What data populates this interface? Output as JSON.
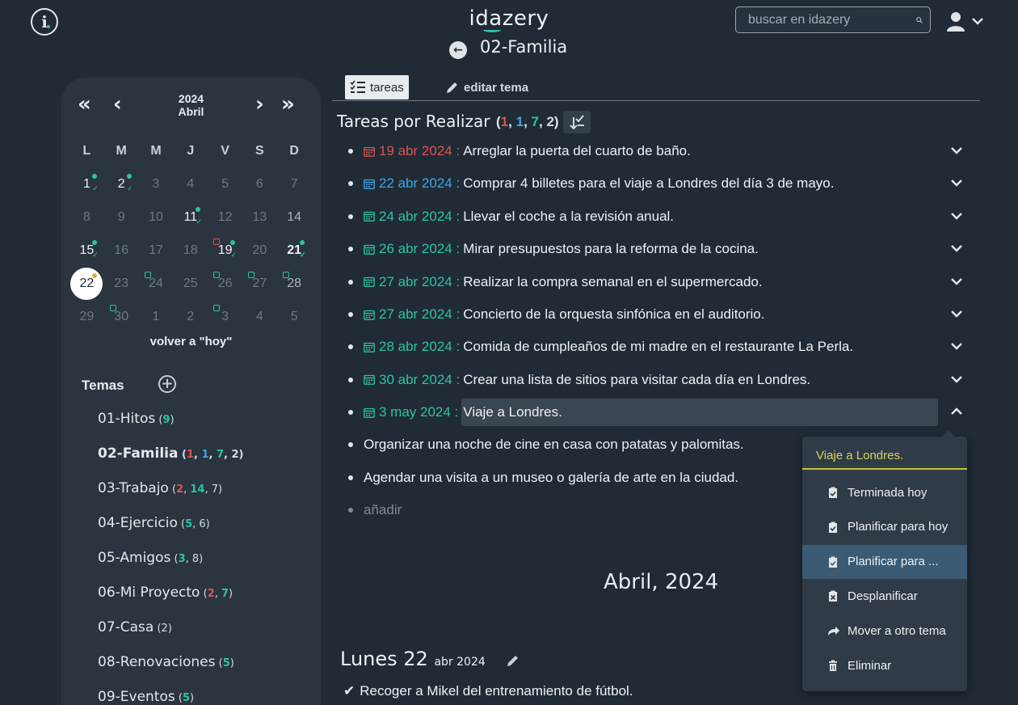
{
  "header": {
    "logo": "idazery",
    "page_title": "02-Familia",
    "search_placeholder": "buscar en idazery"
  },
  "calendar": {
    "year": "2024",
    "month": "Abril",
    "weekdays": [
      "L",
      "M",
      "M",
      "J",
      "V",
      "S",
      "D"
    ],
    "today_link": "volver a \"hoy\""
  },
  "temas": {
    "heading": "Temas",
    "items": [
      {
        "name": "01-Hitos",
        "counts": [
          {
            "v": "9",
            "c": "green"
          }
        ]
      },
      {
        "name": "02-Familia",
        "counts": [
          {
            "v": "1",
            "c": "red"
          },
          {
            "v": "1",
            "c": "blue"
          },
          {
            "v": "7",
            "c": "green"
          },
          {
            "v": "2",
            "c": "wh"
          }
        ],
        "selected": true
      },
      {
        "name": "03-Trabajo",
        "counts": [
          {
            "v": "2",
            "c": "red"
          },
          {
            "v": "14",
            "c": "green"
          },
          {
            "v": "7",
            "c": "wh"
          }
        ]
      },
      {
        "name": "04-Ejercicio",
        "counts": [
          {
            "v": "5",
            "c": "green"
          },
          {
            "v": "6",
            "c": "wh"
          }
        ]
      },
      {
        "name": "05-Amigos",
        "counts": [
          {
            "v": "3",
            "c": "green"
          },
          {
            "v": "8",
            "c": "wh"
          }
        ]
      },
      {
        "name": "06-Mi Proyecto",
        "counts": [
          {
            "v": "2",
            "c": "red"
          },
          {
            "v": "7",
            "c": "green"
          }
        ]
      },
      {
        "name": "07-Casa",
        "counts": [
          {
            "v": "2",
            "c": "wh"
          }
        ]
      },
      {
        "name": "08-Renovaciones",
        "counts": [
          {
            "v": "5",
            "c": "green"
          }
        ]
      },
      {
        "name": "09-Eventos",
        "counts": [
          {
            "v": "5",
            "c": "green"
          }
        ]
      }
    ]
  },
  "tabs": {
    "tareas": "tareas",
    "editar": "editar tema"
  },
  "section": {
    "title": "Tareas por Realizar",
    "counts": [
      {
        "v": "1",
        "c": "red"
      },
      {
        "v": "1",
        "c": "blue"
      },
      {
        "v": "7",
        "c": "green"
      },
      {
        "v": "2",
        "c": "wh"
      }
    ]
  },
  "tasks": [
    {
      "date": "19 abr 2024 :",
      "text": "Arreglar la puerta del cuarto de baño.",
      "color": "#e0524f"
    },
    {
      "date": "22 abr 2024 :",
      "text": "Comprar 4 billetes para el viaje a Londres del día 3 de mayo.",
      "color": "#3ea6e8"
    },
    {
      "date": "24 abr 2024 :",
      "text": "Llevar el coche a la revisión anual.",
      "color": "#2cc3a5"
    },
    {
      "date": "26 abr 2024 :",
      "text": "Mirar presupuestos para la reforma de la cocina.",
      "color": "#2cc3a5"
    },
    {
      "date": "27 abr 2024 :",
      "text": "Realizar la compra semanal en el supermercado.",
      "color": "#2cc3a5"
    },
    {
      "date": "27 abr 2024 :",
      "text": "Concierto de la orquesta sinfónica en el auditorio.",
      "color": "#2cc3a5"
    },
    {
      "date": "28 abr 2024 :",
      "text": "Comida de cumpleaños de mi madre en el restaurante La Perla.",
      "color": "#2cc3a5"
    },
    {
      "date": "30 abr 2024 :",
      "text": "Crear una lista de sitios para visitar cada día en Londres.",
      "color": "#2cc3a5"
    },
    {
      "date": "3 may 2024 :",
      "text": "Viaje a Londres.",
      "color": "#2cc3a5"
    }
  ],
  "unplanned": [
    "Organizar una noche de cine en casa con patatas y palomitas.",
    "Agendar una visita a un museo o galería de arte en la ciudad."
  ],
  "add_label": "añadir",
  "month_heading": "Abril, 2024",
  "day": {
    "title": "Lunes 22",
    "date": "abr 2024",
    "done_task": "Recoger a Mikel del entrenamiento de fútbol."
  },
  "popup": {
    "title": "Viaje a Londres.",
    "items": [
      "Terminada hoy",
      "Planificar para hoy",
      "Planificar para ...",
      "Desplanificar",
      "Mover a otro tema",
      "Eliminar"
    ]
  },
  "colors": {
    "accent": "#2cc3a5",
    "overdue": "#e0524f",
    "today": "#3ea6e8",
    "bg": "#202b36"
  }
}
